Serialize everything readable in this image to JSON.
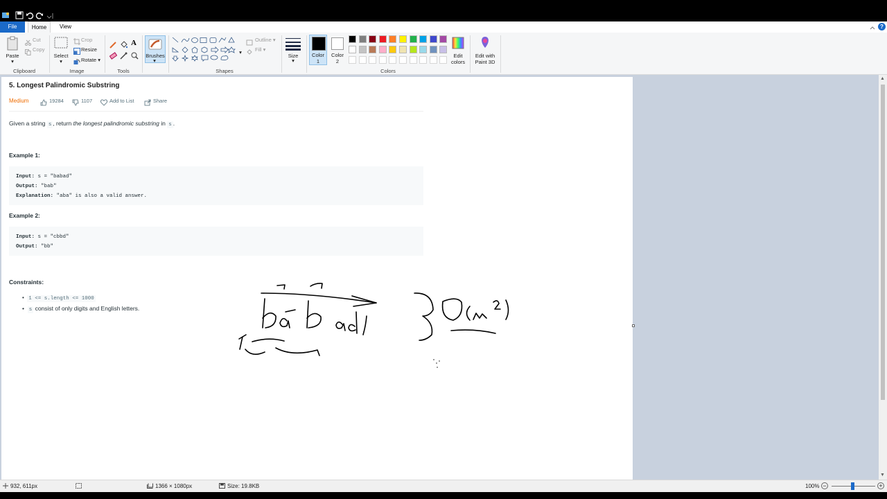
{
  "ribbon": {
    "tabs": {
      "file": "File",
      "home": "Home",
      "view": "View"
    },
    "clipboard": {
      "paste": "Paste",
      "cut": "Cut",
      "copy": "Copy",
      "group": "Clipboard"
    },
    "image": {
      "select": "Select",
      "crop": "Crop",
      "resize": "Resize",
      "rotate": "Rotate",
      "group": "Image"
    },
    "tools": {
      "group": "Tools"
    },
    "brushes": {
      "label": "Brushes"
    },
    "shapes": {
      "outline": "Outline",
      "fill": "Fill",
      "group": "Shapes"
    },
    "size": {
      "label": "Size"
    },
    "color1": {
      "line1": "Color",
      "line2": "1"
    },
    "color2": {
      "line1": "Color",
      "line2": "2"
    },
    "colors": {
      "group": "Colors"
    },
    "edit_colors": {
      "line1": "Edit",
      "line2": "colors"
    },
    "paint3d": {
      "line1": "Edit with",
      "line2": "Paint 3D"
    },
    "palette_row1": [
      "#000000",
      "#7f7f7f",
      "#880015",
      "#ed1c24",
      "#ff7f27",
      "#fff200",
      "#22b14c",
      "#00a2e8",
      "#3f48cc",
      "#a349a4"
    ],
    "palette_row2": [
      "#ffffff",
      "#c3c3c3",
      "#b97a57",
      "#ffaec9",
      "#ffc90e",
      "#efe4b0",
      "#b5e61d",
      "#99d9ea",
      "#7092be",
      "#c8bfe7"
    ],
    "help": "?"
  },
  "problem": {
    "title": "5. Longest Palindromic Substring",
    "difficulty": "Medium",
    "likes": "19284",
    "dislikes": "1107",
    "add_to_list": "Add to List",
    "share": "Share",
    "desc": {
      "p1": "Given a string ",
      "v1": "s",
      "p2": ", return ",
      "em": "the longest palindromic substring",
      "p3": " in ",
      "v2": "s",
      "p4": "."
    },
    "example1": {
      "heading": "Example 1:",
      "input_label": "Input:",
      "input": "s = \"babad\"",
      "output_label": "Output:",
      "output": "\"bab\"",
      "expl_label": "Explanation:",
      "expl": "\"aba\" is also a valid answer."
    },
    "example2": {
      "heading": "Example 2:",
      "input_label": "Input:",
      "input": "s = \"cbbd\"",
      "output_label": "Output:",
      "output": "\"bb\""
    },
    "constraints": {
      "heading": "Constraints:",
      "c1": "1 <= s.length <= 1000",
      "c2_code": "s",
      "c2_text": " consist of only digits and English letters."
    }
  },
  "status": {
    "cursor": "932, 611px",
    "dimensions": "1366 × 1080px",
    "size": "Size: 19.8KB",
    "zoom": "100%"
  }
}
